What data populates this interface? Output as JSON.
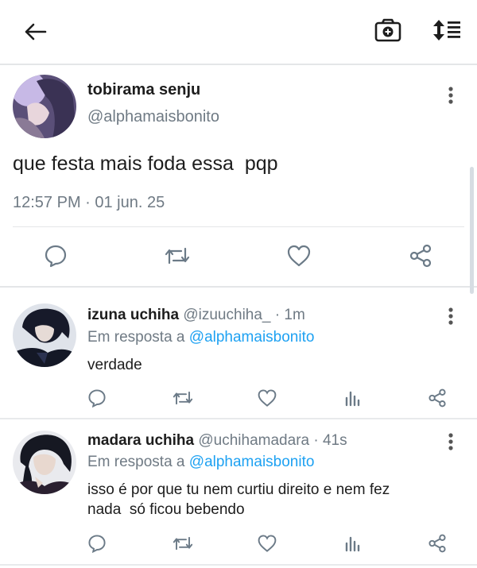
{
  "colors": {
    "accent": "#1da1f2",
    "muted": "#6f7a84",
    "icon": "#6b7a87",
    "divider": "#e4e6e8"
  },
  "header": {
    "back_icon": "arrow-left-icon",
    "camera_icon": "camera-plus-icon",
    "sort_icon": "sort-list-icon"
  },
  "tweet": {
    "display_name": "tobirama senju",
    "handle": "@alphamaisbonito",
    "text": "que festa mais foda essa  pqp",
    "timestamp": "12:57 PM · 01 jun. 25"
  },
  "replies": [
    {
      "display_name": "izuna uchiha",
      "handle_time": "@izuuchiha_ · 1m",
      "reply_prefix": "Em resposta a",
      "reply_to": "@alphamaisbonito",
      "text": [
        "verdade"
      ]
    },
    {
      "display_name": "madara uchiha",
      "handle_time": "@uchihamadara · 41s",
      "reply_prefix": "Em resposta a",
      "reply_to": "@alphamaisbonito",
      "text": [
        "isso é por que tu nem curtiu direito e nem fez",
        "nada  só ficou bebendo"
      ]
    }
  ]
}
